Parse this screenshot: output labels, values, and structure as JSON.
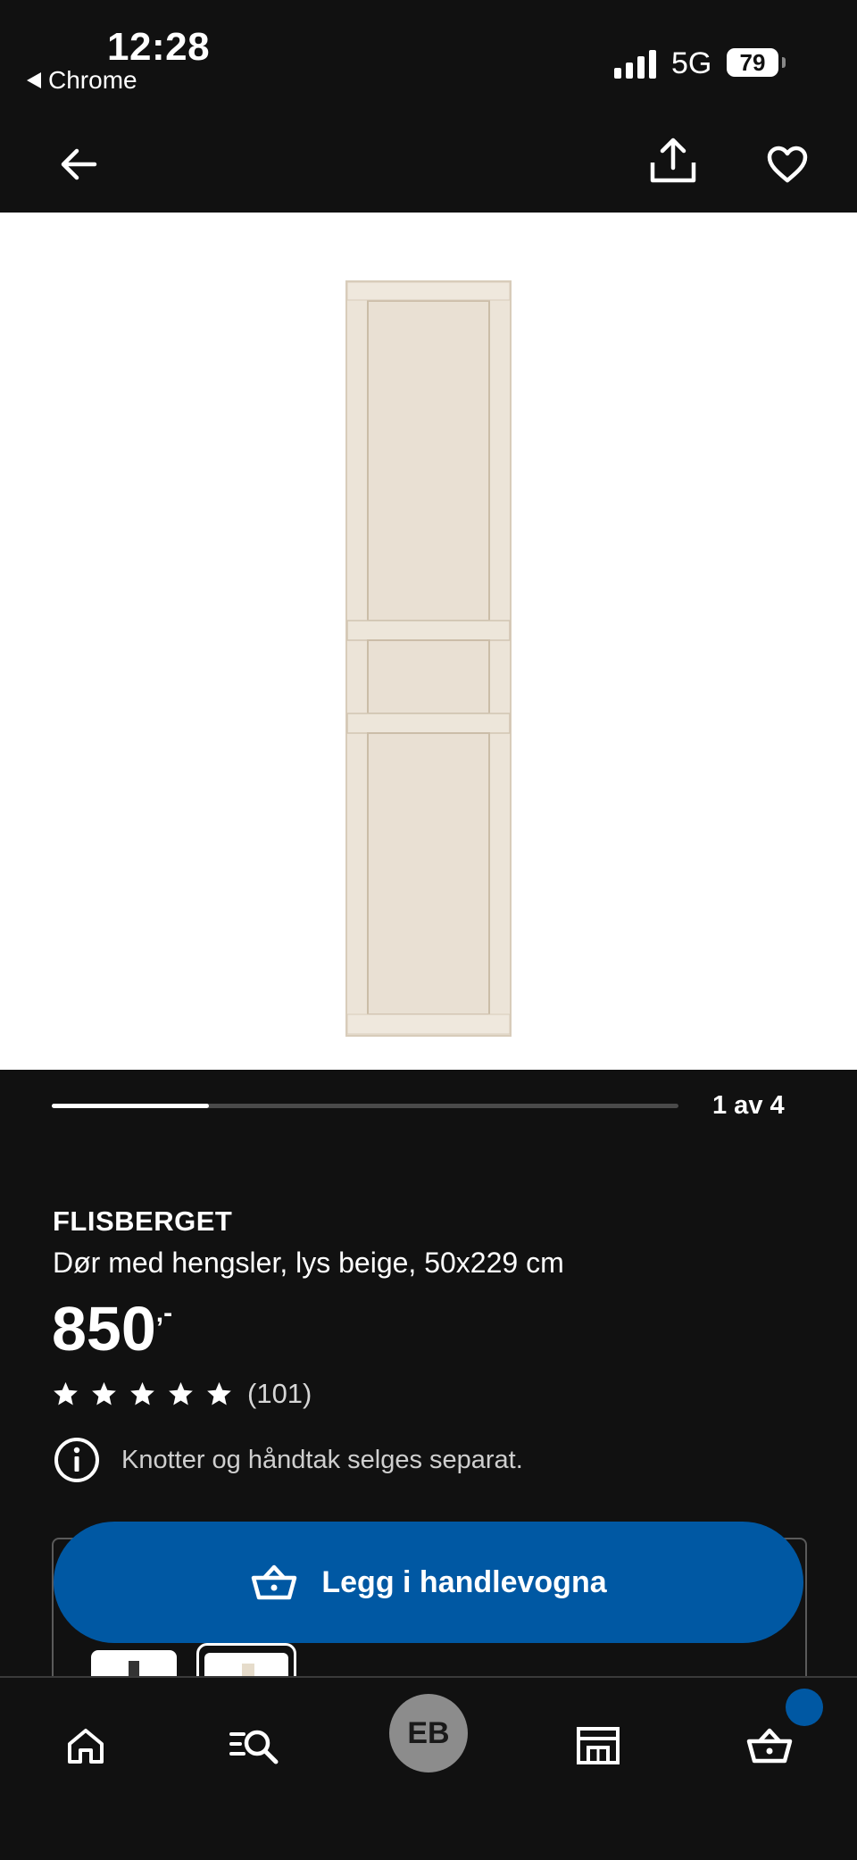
{
  "status_bar": {
    "time": "12:28",
    "back_app": "Chrome",
    "network": "5G",
    "battery": "79"
  },
  "top_nav": {
    "back_icon": "arrow-left-icon",
    "share_icon": "share-icon",
    "favorite_icon": "heart-icon"
  },
  "gallery": {
    "counter": "1 av 4",
    "current_fraction": 0.25
  },
  "product": {
    "name": "FLISBERGET",
    "description": "Dør med hengsler, lys beige, 50x229 cm",
    "price": "850",
    "price_suffix": ",-",
    "rating_stars": 5,
    "rating_count": "(101)",
    "notice": "Knotter og håndtak selges separat."
  },
  "cta": {
    "label": "Legg i handlevogna",
    "icon": "basket-icon"
  },
  "bottom_nav": {
    "items": [
      {
        "name": "home",
        "icon": "home-icon"
      },
      {
        "name": "search",
        "icon": "search-list-icon"
      },
      {
        "name": "profile",
        "initials": "EB"
      },
      {
        "name": "store",
        "icon": "store-icon"
      },
      {
        "name": "cart",
        "icon": "basket-icon"
      }
    ]
  },
  "colors": {
    "background": "#111111",
    "accent": "#0058a3",
    "door": "#ece4d8"
  }
}
